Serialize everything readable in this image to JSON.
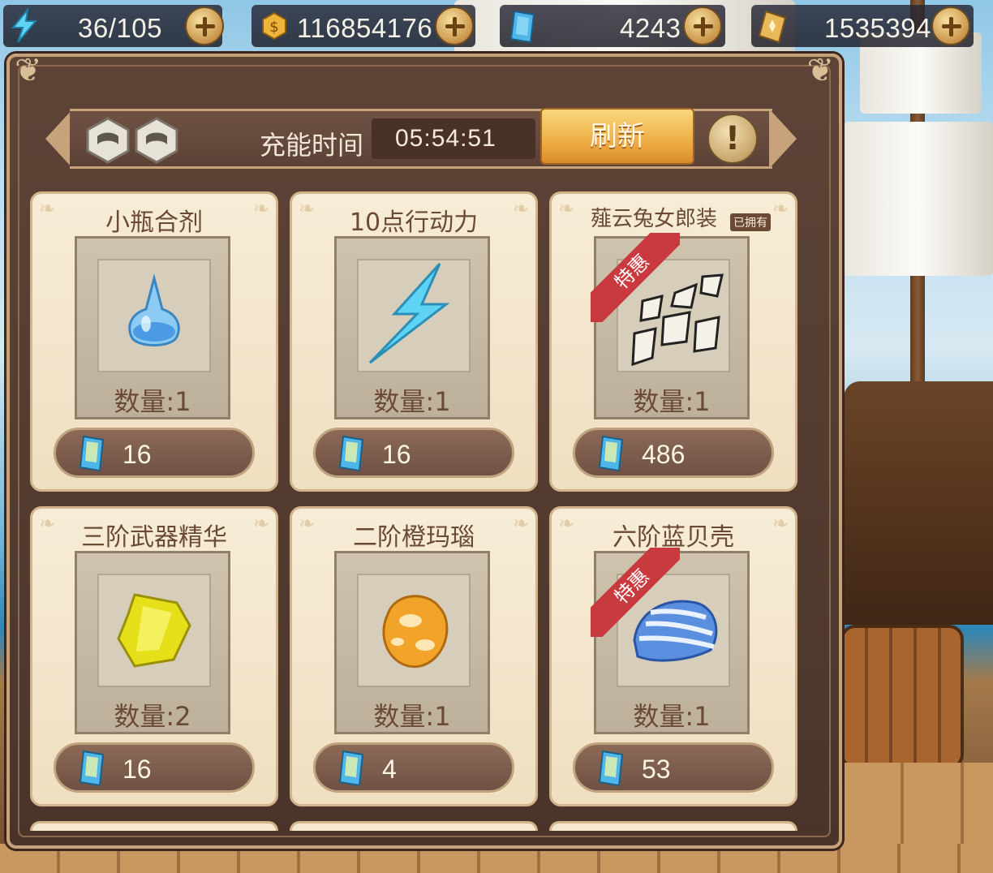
{
  "top_bar": {
    "stamina": {
      "icon": "lightning-icon",
      "value": "36/105"
    },
    "coins": {
      "icon": "coin-icon",
      "value": "116854176"
    },
    "gems": {
      "icon": "gem-icon",
      "value": "4243"
    },
    "vouchers": {
      "icon": "ticket-icon",
      "value": "1535394"
    }
  },
  "shop": {
    "charge_label": "充能时间",
    "charge_timer": "05:54:51",
    "refresh_label": "刷新",
    "info_label": "!",
    "items": [
      {
        "name": "小瓶合剂",
        "quantity": "数量:1",
        "price": "16",
        "icon": "potion-bottle-icon",
        "badge": ""
      },
      {
        "name": "10点行动力",
        "quantity": "数量:1",
        "price": "16",
        "icon": "lightning-bolt-icon",
        "badge": ""
      },
      {
        "name": "薤云兔女郎装",
        "owned": "已拥有",
        "quantity": "数量:1",
        "price": "486",
        "icon": "costume-fragment-icon",
        "badge": "特惠"
      },
      {
        "name": "三阶武器精华",
        "quantity": "数量:2",
        "price": "16",
        "icon": "yellow-crystal-icon",
        "badge": ""
      },
      {
        "name": "二阶橙玛瑙",
        "quantity": "数量:1",
        "price": "4",
        "icon": "orange-agate-icon",
        "badge": ""
      },
      {
        "name": "六阶蓝贝壳",
        "quantity": "数量:1",
        "price": "53",
        "icon": "blue-shell-icon",
        "badge": "特惠"
      }
    ]
  },
  "colors": {
    "accent": "#eeae45",
    "badge": "#c93a3f",
    "panel": "#5e4437",
    "card": "#f7ecd6"
  }
}
